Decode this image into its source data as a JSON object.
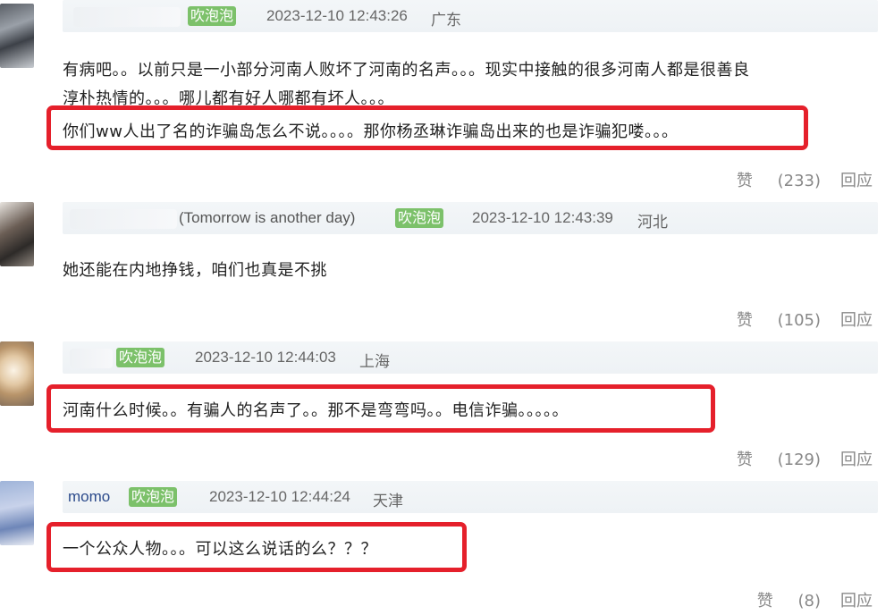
{
  "comments": [
    {
      "username": "",
      "badge": "吹泡泡",
      "time": "2023-12-10 12:43:26",
      "location": "广东",
      "lines": [
        "有病吧。。以前只是一小部分河南人败坏了河南的名声。。。现实中接触的很多河南人都是很善良",
        "淳朴热情的。。。哪儿都有好人哪都有坏人。。。",
        "你们ww人出了名的诈骗岛怎么不说。。。。那你杨丞琳诈骗岛出来的也是诈骗犯喽。。。"
      ],
      "like_label": "赞",
      "like_count": "(233)",
      "reply_label": "回应"
    },
    {
      "username": "(Tomorrow is another day)",
      "badge": "吹泡泡",
      "time": "2023-12-10 12:43:39",
      "location": "河北",
      "lines": [
        "她还能在内地挣钱，咱们也真是不挑"
      ],
      "like_label": "赞",
      "like_count": "(105)",
      "reply_label": "回应"
    },
    {
      "username": "",
      "badge": "吹泡泡",
      "time": "2023-12-10 12:44:03",
      "location": "上海",
      "lines": [
        "河南什么时候。。有骗人的名声了。。那不是弯弯吗。。电信诈骗。。。。。"
      ],
      "like_label": "赞",
      "like_count": "(129)",
      "reply_label": "回应"
    },
    {
      "username": "momo",
      "badge": "吹泡泡",
      "time": "2023-12-10 12:44:24",
      "location": "天津",
      "lines": [
        "一个公众人物。。。可以这么说话的么？？？"
      ],
      "like_label": "赞",
      "like_count": "(8)",
      "reply_label": "回应"
    }
  ],
  "colors": {
    "highlight": "#e5202b",
    "badge": "#7cc16a",
    "username": "#2b4a8b"
  }
}
